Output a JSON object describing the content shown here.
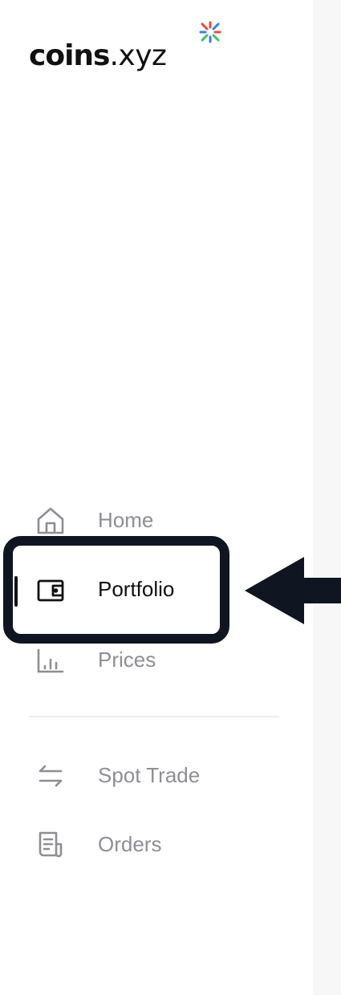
{
  "brand": {
    "name_bold": "coins",
    "name_light": ".xyz"
  },
  "nav": {
    "primary": [
      {
        "label": "Home",
        "icon": "home-icon",
        "active": false
      },
      {
        "label": "Portfolio",
        "icon": "wallet-icon",
        "active": true
      },
      {
        "label": "Prices",
        "icon": "bar-chart-icon",
        "active": false
      }
    ],
    "secondary": [
      {
        "label": "Spot Trade",
        "icon": "swap-arrows-icon",
        "active": false
      },
      {
        "label": "Orders",
        "icon": "document-icon",
        "active": false
      }
    ]
  },
  "annotation": {
    "highlight_color": "#101522",
    "arrow_color": "#101522"
  },
  "colors": {
    "active_text": "#111111",
    "inactive_text": "#8e8e95",
    "logo_mark_red": "#e84a3a",
    "logo_mark_blue": "#3a7bf0",
    "logo_mark_green": "#39c26a"
  }
}
